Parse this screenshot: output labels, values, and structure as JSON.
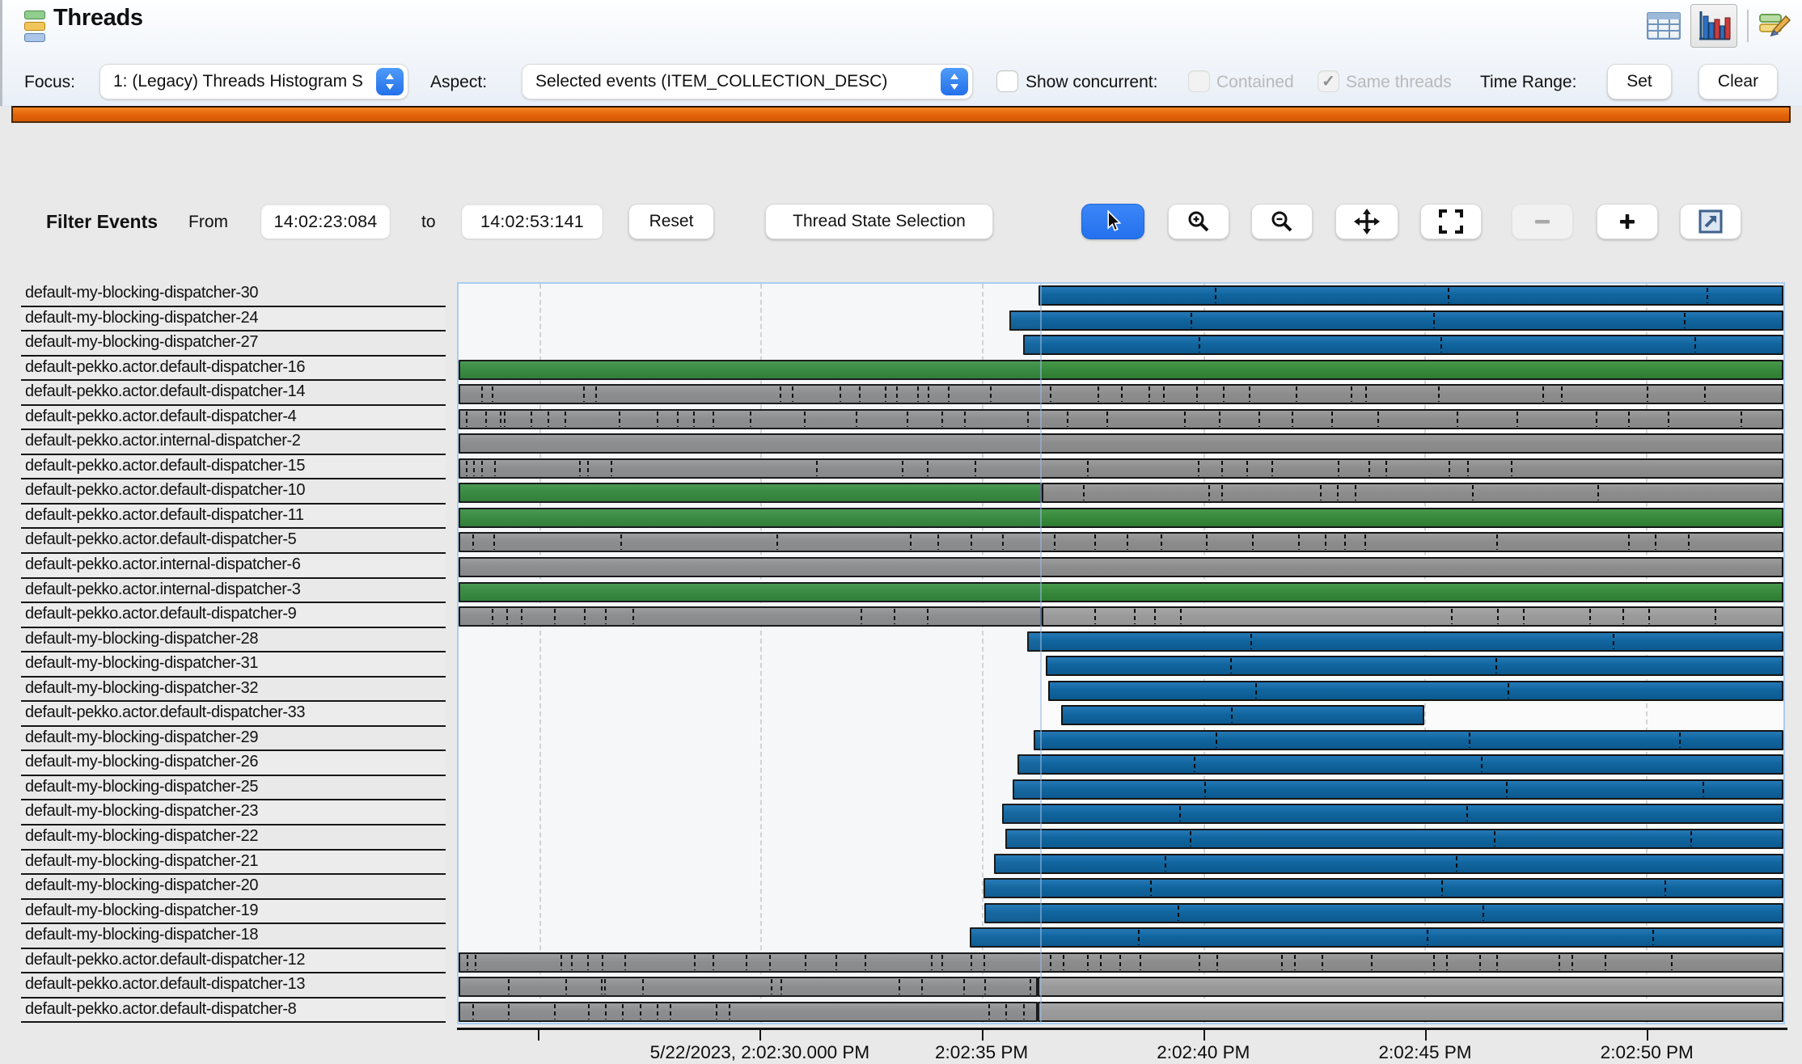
{
  "header": {
    "title": "Threads",
    "focus_label": "Focus:",
    "focus_value": "1: (Legacy) Threads Histogram S",
    "aspect_label": "Aspect:",
    "aspect_value": "Selected events (ITEM_COLLECTION_DESC)",
    "show_concurrent_label": "Show concurrent:",
    "contained_label": "Contained",
    "same_threads_label": "Same threads",
    "same_threads_check": "✓",
    "time_range_label": "Time Range:",
    "set_label": "Set",
    "clear_label": "Clear"
  },
  "filter": {
    "title": "Filter Events",
    "from_label": "From",
    "from_value": "14:02:23:084",
    "to_label": "to",
    "to_value": "14:02:53:141",
    "reset_label": "Reset",
    "thread_state_label": "Thread State Selection"
  },
  "icons": {
    "title_icon": "stacked-layers",
    "view_table": "table-view",
    "view_chart": "bar-chart-view-selected",
    "view_edit": "edit-pencil",
    "toolbar": [
      "cursor-arrow",
      "magnifier-plus",
      "magnifier-minus",
      "move-arrows",
      "fullscreen-corners",
      "minus",
      "plus",
      "open-external"
    ]
  },
  "colors": {
    "bar_blue": "#11659e",
    "bar_green": "#388a3c",
    "bar_gray": "#8f8f8f",
    "accent_button_blue": "#2e7cf5",
    "orange_strip": "#e2620a",
    "selection_border": "#a9cdf3"
  },
  "chart_data": {
    "type": "timeline-gantt",
    "title": "Threads timeline (thread state per thread over time)",
    "x_start_label": "14:02:23:084",
    "x_end_label": "14:02:53:141",
    "gridlines_pct": [
      6.1,
      22.8,
      39.5,
      56.2,
      72.9,
      89.6
    ],
    "selection_end_pct": 43.9,
    "axis": {
      "minor_ticks_pct": [
        6.1
      ],
      "labels": [
        {
          "pct": 22.8,
          "text": "5/22/2023, 2:02:30.000 PM"
        },
        {
          "pct": 39.5,
          "text": "2:02:35 PM"
        },
        {
          "pct": 56.2,
          "text": "2:02:40 PM"
        },
        {
          "pct": 72.9,
          "text": "2:02:45 PM"
        },
        {
          "pct": 89.6,
          "text": "2:02:50 PM"
        }
      ]
    },
    "rows": [
      {
        "thread": "default-my-blocking-dispatcher-30",
        "segments": [
          {
            "color": "blue",
            "start": 43.8,
            "end": 100,
            "ticks": [
              57.0,
              74.7,
              94.3
            ]
          }
        ]
      },
      {
        "thread": "default-my-blocking-dispatcher-24",
        "segments": [
          {
            "color": "blue",
            "start": 41.6,
            "end": 100,
            "ticks": [
              55.2,
              73.6,
              92.6
            ]
          }
        ]
      },
      {
        "thread": "default-my-blocking-dispatcher-27",
        "segments": [
          {
            "color": "blue",
            "start": 42.6,
            "end": 100,
            "ticks": [
              55.8,
              74.1,
              93.4
            ]
          }
        ]
      },
      {
        "thread": "default-pekko.actor.default-dispatcher-16",
        "segments": [
          {
            "color": "green",
            "start": 0,
            "end": 100,
            "ticks": []
          }
        ]
      },
      {
        "thread": "default-pekko.actor.default-dispatcher-14",
        "segments": [
          {
            "color": "gray",
            "start": 0,
            "end": 100,
            "ticks": [
              1.6,
              2.4,
              9.3,
              10.2,
              24.2,
              25.1,
              28.7,
              30.2,
              32.1,
              33.0,
              34.6,
              35.4,
              36.9,
              40.1,
              44.6,
              48.2,
              50.0,
              52.1,
              53.2,
              55.7,
              57.7,
              59.7,
              63.2,
              67.4,
              68.5,
              74.0,
              81.9,
              83.3,
              89.8,
              94.1
            ]
          }
        ]
      },
      {
        "thread": "default-pekko.actor.default-dispatcher-4",
        "segments": [
          {
            "color": "gray",
            "start": 0,
            "end": 100,
            "ticks": [
              0.4,
              1.9,
              3.0,
              3.3,
              5.3,
              6.6,
              7.9,
              12.0,
              14.9,
              16.4,
              17.6,
              19.1,
              21.9,
              26.0,
              29.9,
              33.8,
              36.4,
              38.1,
              42.9,
              45.9,
              48.9,
              54.8,
              57.4,
              60.4,
              62.9,
              65.9,
              69.4,
              75.4,
              79.9,
              85.9,
              88.4,
              91.4,
              96.9
            ]
          }
        ]
      },
      {
        "thread": "default-pekko.actor.internal-dispatcher-2",
        "segments": [
          {
            "color": "gray",
            "start": 0,
            "end": 100,
            "ticks": []
          }
        ]
      },
      {
        "thread": "default-pekko.actor.default-dispatcher-15",
        "segments": [
          {
            "color": "gray",
            "start": 0,
            "end": 100,
            "ticks": [
              0.4,
              1.0,
              1.6,
              2.6,
              9.0,
              9.6,
              11.4,
              26.9,
              33.4,
              35.3,
              38.9,
              47.4,
              55.8,
              57.6,
              59.5,
              61.4,
              66.4,
              68.7,
              70.0,
              74.8,
              76.2,
              79.5
            ]
          }
        ]
      },
      {
        "thread": "default-pekko.actor.default-dispatcher-10",
        "segments": [
          {
            "color": "green",
            "start": 0,
            "end": 44.0,
            "ticks": []
          },
          {
            "color": "gray",
            "start": 44.0,
            "end": 100,
            "ticks": [
              47.0,
              56.5,
              57.5,
              65.0,
              66.3,
              67.6,
              76.5,
              86.0
            ]
          }
        ]
      },
      {
        "thread": "default-pekko.actor.default-dispatcher-11",
        "segments": [
          {
            "color": "green",
            "start": 0,
            "end": 100,
            "ticks": []
          }
        ]
      },
      {
        "thread": "default-pekko.actor.default-dispatcher-5",
        "segments": [
          {
            "color": "gray",
            "start": 0,
            "end": 100,
            "ticks": [
              0.9,
              2.5,
              12.1,
              23.9,
              34.0,
              36.1,
              38.6,
              41.0,
              44.9,
              48.0,
              50.4,
              53.0,
              56.4,
              59.9,
              63.4,
              65.4,
              66.9,
              68.4,
              78.4,
              88.4,
              90.4,
              92.9
            ]
          }
        ]
      },
      {
        "thread": "default-pekko.actor.internal-dispatcher-6",
        "segments": [
          {
            "color": "gray",
            "start": 0,
            "end": 100,
            "ticks": []
          }
        ]
      },
      {
        "thread": "default-pekko.actor.internal-dispatcher-3",
        "segments": [
          {
            "color": "green",
            "start": 0,
            "end": 100,
            "ticks": []
          }
        ]
      },
      {
        "thread": "default-pekko.actor.default-dispatcher-9",
        "segments": [
          {
            "color": "gray",
            "start": 0,
            "end": 44.0,
            "ticks": [
              2.4,
              3.5,
              4.6,
              7.1,
              9.4,
              11.0,
              13.1,
              30.4,
              32.9,
              35.4
            ]
          },
          {
            "color": "gray2",
            "start": 44.0,
            "end": 100,
            "ticks": [
              47.9,
              50.9,
              52.4,
              54.4,
              74.9,
              78.4,
              80.4,
              85.4,
              87.9,
              89.9,
              94.9
            ]
          }
        ]
      },
      {
        "thread": "default-my-blocking-dispatcher-28",
        "segments": [
          {
            "color": "blue",
            "start": 42.9,
            "end": 100,
            "ticks": [
              59.7,
              87.2
            ]
          }
        ]
      },
      {
        "thread": "default-my-blocking-dispatcher-31",
        "segments": [
          {
            "color": "blue",
            "start": 44.3,
            "end": 100,
            "ticks": [
              58.2,
              78.3
            ]
          }
        ]
      },
      {
        "thread": "default-my-blocking-dispatcher-32",
        "segments": [
          {
            "color": "blue",
            "start": 44.5,
            "end": 100,
            "ticks": [
              60.1,
              79.2
            ]
          }
        ]
      },
      {
        "thread": "default-pekko.actor.default-dispatcher-33",
        "segments": [
          {
            "color": "blue",
            "start": 45.5,
            "end": 72.9,
            "ticks": [
              58.3
            ]
          }
        ]
      },
      {
        "thread": "default-my-blocking-dispatcher-29",
        "segments": [
          {
            "color": "blue",
            "start": 43.4,
            "end": 100,
            "ticks": [
              57.1,
              76.3,
              92.2
            ]
          }
        ]
      },
      {
        "thread": "default-my-blocking-dispatcher-26",
        "segments": [
          {
            "color": "blue",
            "start": 42.2,
            "end": 100,
            "ticks": [
              55.4,
              77.2
            ]
          }
        ]
      },
      {
        "thread": "default-my-blocking-dispatcher-25",
        "segments": [
          {
            "color": "blue",
            "start": 41.8,
            "end": 100,
            "ticks": [
              56.2,
              79.1,
              94.0
            ]
          }
        ]
      },
      {
        "thread": "default-my-blocking-dispatcher-23",
        "segments": [
          {
            "color": "blue",
            "start": 41.0,
            "end": 100,
            "ticks": [
              54.3,
              76.1
            ]
          }
        ]
      },
      {
        "thread": "default-my-blocking-dispatcher-22",
        "segments": [
          {
            "color": "blue",
            "start": 41.3,
            "end": 100,
            "ticks": [
              55.1,
              78.2,
              93.1
            ]
          }
        ]
      },
      {
        "thread": "default-my-blocking-dispatcher-21",
        "segments": [
          {
            "color": "blue",
            "start": 40.4,
            "end": 100,
            "ticks": [
              53.2,
              75.3
            ]
          }
        ]
      },
      {
        "thread": "default-my-blocking-dispatcher-20",
        "segments": [
          {
            "color": "blue",
            "start": 39.6,
            "end": 100,
            "ticks": [
              52.1,
              74.2,
              91.1
            ]
          }
        ]
      },
      {
        "thread": "default-my-blocking-dispatcher-19",
        "segments": [
          {
            "color": "blue",
            "start": 39.7,
            "end": 100,
            "ticks": [
              54.2,
              77.3
            ]
          }
        ]
      },
      {
        "thread": "default-my-blocking-dispatcher-18",
        "segments": [
          {
            "color": "blue",
            "start": 38.6,
            "end": 100,
            "ticks": [
              51.2,
              73.1,
              90.2
            ]
          }
        ]
      },
      {
        "thread": "default-pekko.actor.default-dispatcher-12",
        "segments": [
          {
            "color": "gray",
            "start": 0,
            "end": 100,
            "ticks": [
              0.5,
              1.1,
              7.6,
              8.4,
              9.6,
              10.7,
              12.4,
              17.7,
              19.1,
              21.6,
              23.4,
              26.1,
              28.4,
              30.6,
              35.6,
              36.4,
              38.6,
              39.6,
              44.6,
              45.6,
              47.4,
              48.4,
              49.9,
              51.4,
              55.9,
              57.2,
              62.1,
              63.1,
              65.2,
              68.9,
              73.6,
              74.6,
              77.1,
              78.4,
              83.1,
              84.1,
              86.6,
              91.6
            ]
          }
        ]
      },
      {
        "thread": "default-pekko.actor.default-dispatcher-13",
        "segments": [
          {
            "color": "gray",
            "start": 0,
            "end": 43.7,
            "ticks": [
              3.6,
              8.0,
              10.7,
              10.9,
              13.8,
              23.6,
              24.3,
              33.3,
              35.0,
              38.2,
              39.8,
              43.2
            ]
          },
          {
            "color": "gray2",
            "start": 43.7,
            "end": 100,
            "ticks": []
          }
        ]
      },
      {
        "thread": "default-pekko.actor.default-dispatcher-8",
        "segments": [
          {
            "color": "gray",
            "start": 0,
            "end": 43.7,
            "ticks": [
              0.9,
              3.6,
              7.1,
              9.7,
              11.0,
              12.3,
              13.6,
              14.9,
              15.9,
              19.4,
              20.4,
              40.1,
              41.4,
              42.7
            ]
          },
          {
            "color": "gray2",
            "start": 43.7,
            "end": 100,
            "ticks": []
          }
        ]
      }
    ]
  }
}
